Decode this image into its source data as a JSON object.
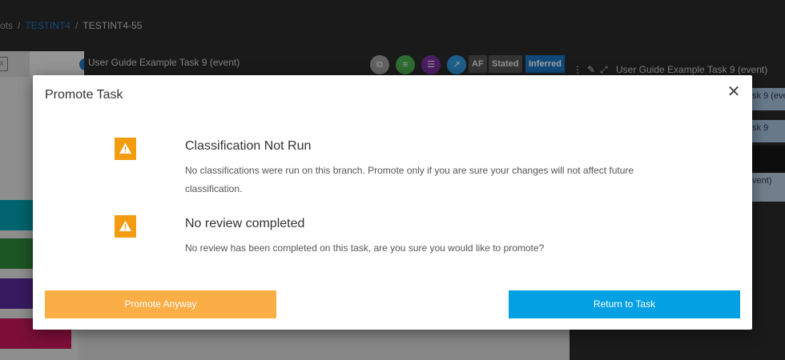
{
  "breadcrumb": {
    "root": "ots",
    "project": "TESTINT4",
    "task": "TESTINT4-55"
  },
  "left_panel": {
    "info_icon": "i"
  },
  "middle_panel": {
    "title": "User Guide Example Task 9 (event)",
    "badges": {
      "af": "AF",
      "stated": "Stated",
      "inferred": "Inferred"
    }
  },
  "right_panel": {
    "title": "User Guide Example Task 9 (event)",
    "rows": [
      "sk 9 (eve",
      "sk 9",
      "vent)"
    ]
  },
  "modal": {
    "title": "Promote Task",
    "close_glyph": "✕",
    "warnings": [
      {
        "title": "Classification Not Run",
        "body": "No classifications were run on this branch. Promote only if you are sure your changes will not affect future classification."
      },
      {
        "title": "No review completed",
        "body": "No review has been completed on this task, are you sure you would like to promote?"
      }
    ],
    "promote_label": "Promote Anyway",
    "return_label": "Return to Task"
  },
  "colors": {
    "warning": "#f39c12",
    "promote": "#fbae46",
    "return": "#03a1e4",
    "link": "#1b77c4"
  }
}
